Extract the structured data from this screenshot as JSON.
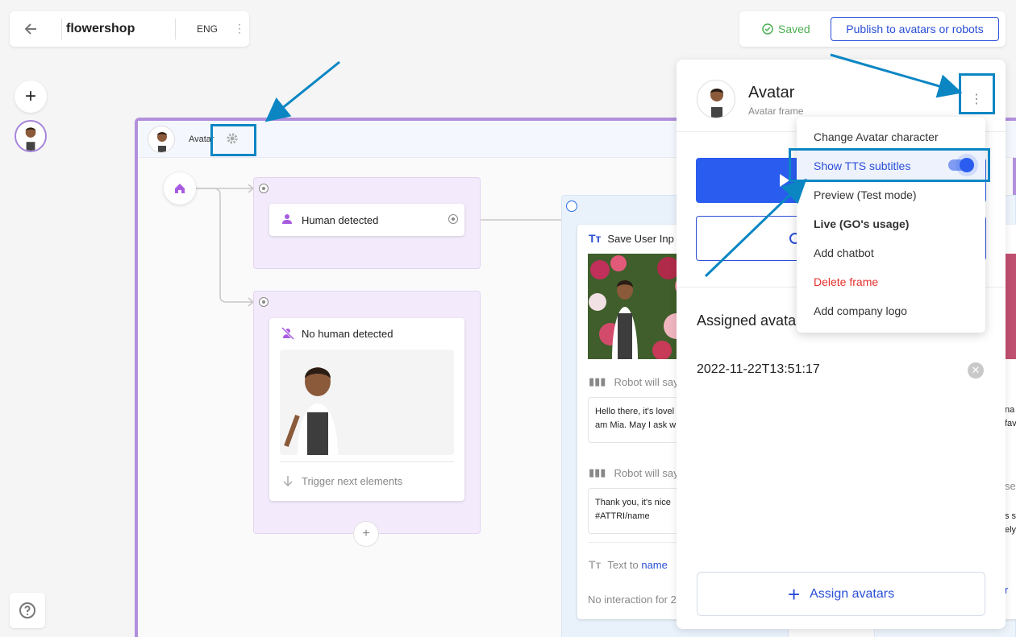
{
  "topbar": {
    "title": "flowershop",
    "language": "ENG"
  },
  "savebar": {
    "status": "Saved",
    "publish_label": "Publish to avatars or robots"
  },
  "frame": {
    "name": "Avatar"
  },
  "nodes": {
    "human_detected": "Human detected",
    "no_human_detected": "No human detected",
    "trigger_next": "Trigger next elements"
  },
  "save_node": {
    "title": "Save User Inp",
    "robot_will_say_1": "Robot will say",
    "message_1_line1": "Hello there, it's lovel",
    "message_1_line2": "am Mia. May I ask w",
    "robot_will_say_2": "Robot will say",
    "message_2_line1": "Thank you, it's nice",
    "message_2_line2": "#ATTRI/name",
    "text_to_prefix": "Text to",
    "text_to_var": "name",
    "no_interaction": "No interaction for 2"
  },
  "peek_node": {
    "line1": "na",
    "line2": "fav",
    "line3": "se",
    "line4": "s s",
    "line5": "ely",
    "line6": "r"
  },
  "panel": {
    "title": "Avatar",
    "subtitle": "Avatar frame",
    "assigned_heading": "Assigned avata",
    "assigned_item": "2022-11-22T13:51:17",
    "assign_button": "Assign avatars"
  },
  "menu": {
    "items": [
      "Change Avatar character",
      "Show TTS subtitles",
      "Preview (Test mode)",
      "Live (GO's usage)",
      "Add chatbot",
      "Delete frame",
      "Add company logo"
    ],
    "show_tts_enabled": true
  },
  "colors": {
    "accent": "#2a5cf0",
    "frame_border": "#b18fdc",
    "saved": "#4caf50",
    "danger": "#e5322d",
    "annotation": "#0b86c3"
  },
  "icons": [
    "back-arrow-icon",
    "kebab-icon",
    "check-circle-icon",
    "plus-icon",
    "help-icon",
    "gear-icon",
    "home-icon",
    "person-icon",
    "person-off-icon",
    "arrow-down-icon",
    "text-icon",
    "sound-wave-icon",
    "play-icon",
    "close-icon"
  ]
}
